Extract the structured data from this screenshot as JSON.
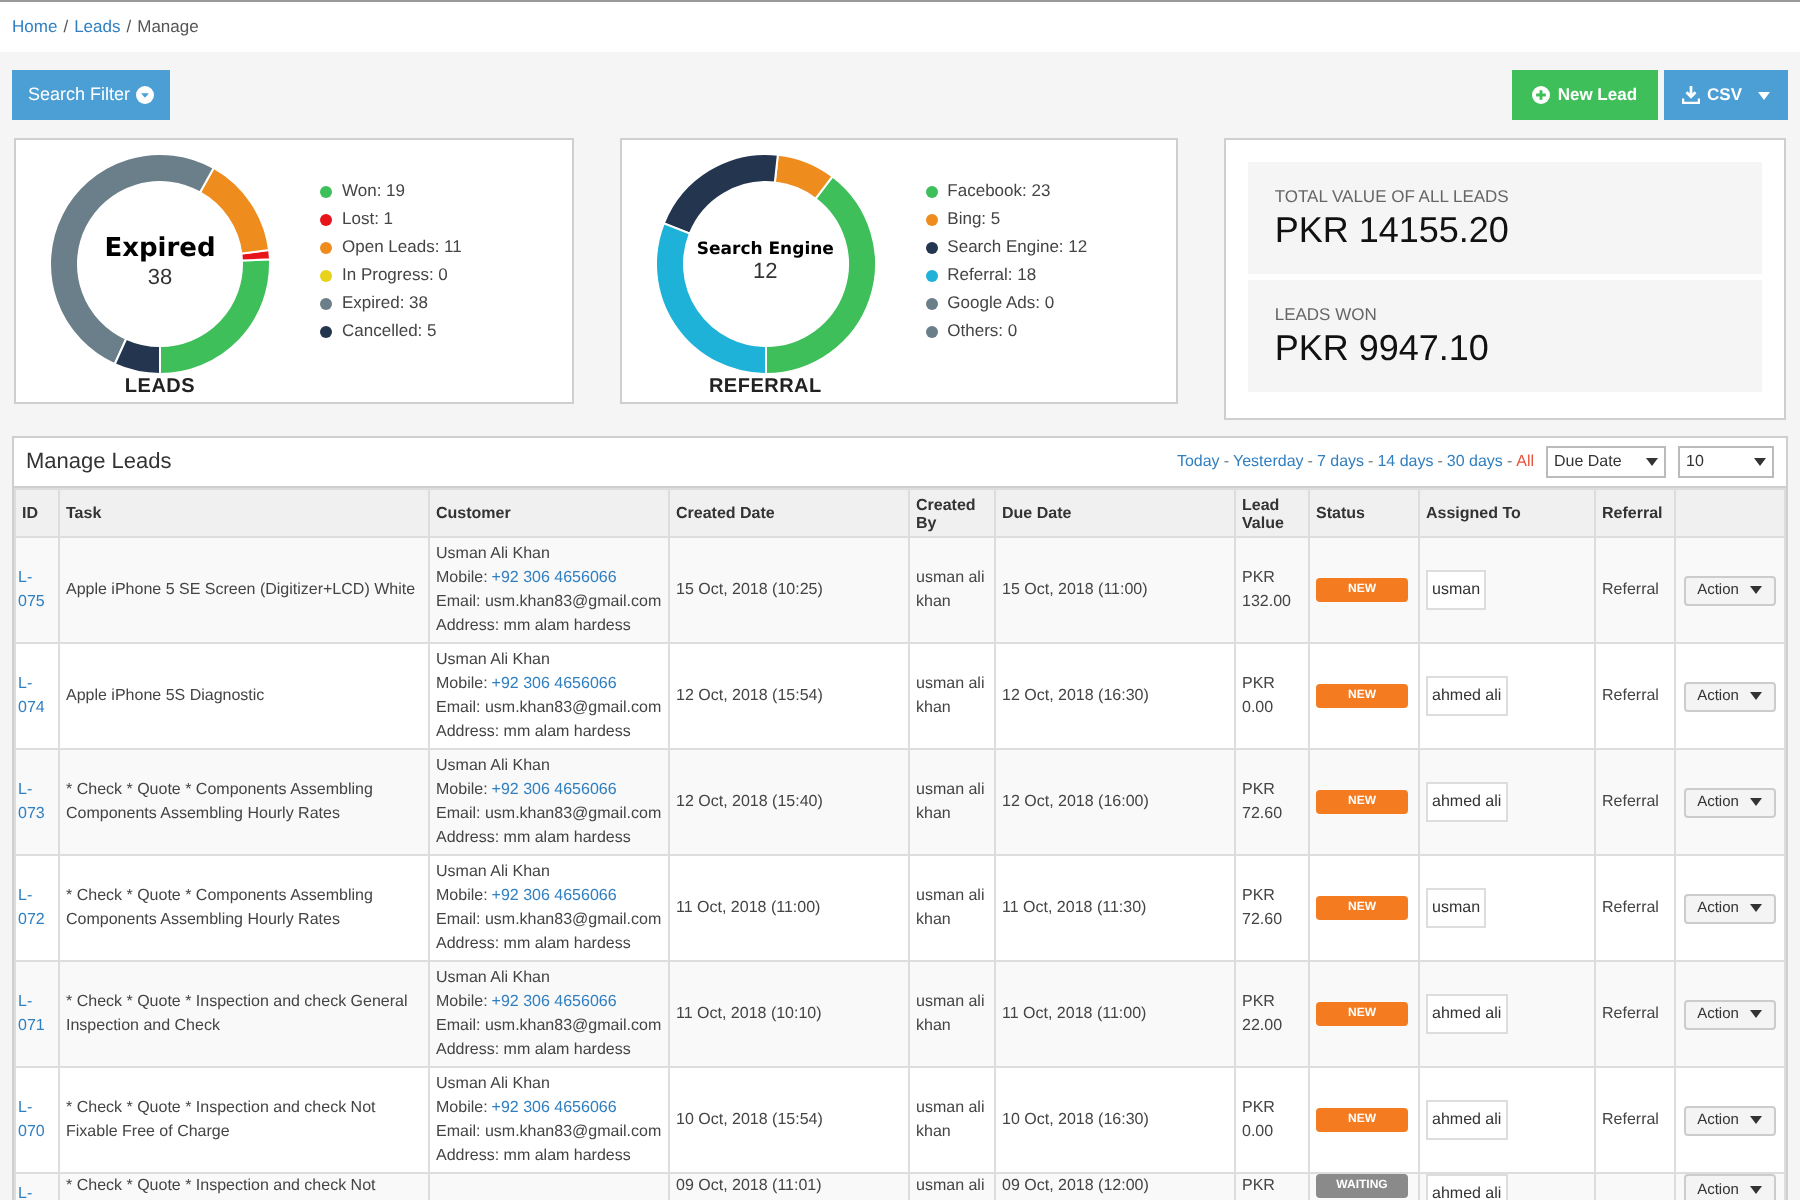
{
  "breadcrumb": {
    "separator": "/",
    "items": [
      {
        "label": "Home",
        "link": true
      },
      {
        "label": "Leads",
        "link": true
      },
      {
        "label": "Manage",
        "link": false
      }
    ]
  },
  "toolbar": {
    "search_filter": "Search Filter",
    "new_lead": "New Lead",
    "csv": "CSV"
  },
  "charts": [
    {
      "center_title": "Expired",
      "center_value": "38",
      "label": "LEADS",
      "legend": [
        {
          "text": "Won: 19",
          "color": "#3fbf5a"
        },
        {
          "text": "Lost: 1",
          "color": "#e8141c"
        },
        {
          "text": "Open Leads: 11",
          "color": "#ef8c1e"
        },
        {
          "text": "In Progress: 0",
          "color": "#e8d21a"
        },
        {
          "text": "Expired: 38",
          "color": "#6b7f8a"
        },
        {
          "text": "Cancelled: 5",
          "color": "#24364f"
        }
      ],
      "chart_data": {
        "type": "donut",
        "values": [
          25.68,
          1.35,
          14.86,
          0,
          51.35,
          6.76
        ]
      }
    },
    {
      "center_title": "Search Engine",
      "center_value": "12",
      "label": "REFERRAL",
      "legend": [
        {
          "text": "Facebook: 23",
          "color": "#3fbf5a"
        },
        {
          "text": "Bing: 5",
          "color": "#ef8c1e"
        },
        {
          "text": "Search Engine: 12",
          "color": "#24364f"
        },
        {
          "text": "Referral: 18",
          "color": "#1fb2d8"
        },
        {
          "text": "Google Ads: 0",
          "color": "#6b7f8a"
        },
        {
          "text": "Others: 0",
          "color": "#6b7f8a"
        }
      ],
      "chart_data": {
        "type": "donut",
        "values": [
          39.66,
          8.62,
          20.69,
          31.03,
          0,
          0
        ]
      }
    }
  ],
  "stats": [
    {
      "label": "TOTAL VALUE OF ALL LEADS",
      "value": "PKR 14155.20"
    },
    {
      "label": "LEADS WON",
      "value": "PKR 9947.10"
    }
  ],
  "panel": {
    "title": "Manage Leads",
    "separator": "-",
    "filters": [
      {
        "label": "Today",
        "selected": false
      },
      {
        "label": "Yesterday",
        "selected": false
      },
      {
        "label": "7 days",
        "selected": false
      },
      {
        "label": "14 days",
        "selected": false
      },
      {
        "label": "30 days",
        "selected": false
      },
      {
        "label": "All",
        "selected": true
      }
    ],
    "sort_select": "Due Date",
    "count_select": "10"
  },
  "table": {
    "columns": [
      "ID",
      "Task",
      "Customer",
      "Created Date",
      "Created By",
      "Due Date",
      "Lead Value",
      "Status",
      "Assigned To",
      "Referral"
    ],
    "rows": [
      {
        "id": "L-075",
        "task": "Apple iPhone 5 SE Screen (Digitizer+LCD) White",
        "customer": {
          "name": "Usman Ali Khan",
          "mobile_label": "Mobile:",
          "mobile": "+92 306 4656066",
          "email": "Email: usm.khan83@gmail.com",
          "address": "Address: mm alam hardess"
        },
        "created": "15 Oct, 2018 (10:25)",
        "created_by": "usman ali khan",
        "due": "15 Oct, 2018 (11:00)",
        "value": "PKR 132.00",
        "status": {
          "text": "NEW",
          "color": "#f47b20"
        },
        "assigned": "usman",
        "referral": "Referral",
        "action": "Action"
      },
      {
        "id": "L-074",
        "task": "Apple iPhone 5S Diagnostic",
        "customer": {
          "name": "Usman Ali Khan",
          "mobile_label": "Mobile:",
          "mobile": "+92 306 4656066",
          "email": "Email: usm.khan83@gmail.com",
          "address": "Address: mm alam hardess"
        },
        "created": "12 Oct, 2018 (15:54)",
        "created_by": "usman ali khan",
        "due": "12 Oct, 2018 (16:30)",
        "value": "PKR 0.00",
        "status": {
          "text": "NEW",
          "color": "#f47b20"
        },
        "assigned": "ahmed ali",
        "referral": "Referral",
        "action": "Action"
      },
      {
        "id": "L-073",
        "task": "* Check * Quote * Components Assembling Components Assembling Hourly Rates",
        "customer": {
          "name": "Usman Ali Khan",
          "mobile_label": "Mobile:",
          "mobile": "+92 306 4656066",
          "email": "Email: usm.khan83@gmail.com",
          "address": "Address: mm alam hardess"
        },
        "created": "12 Oct, 2018 (15:40)",
        "created_by": "usman ali khan",
        "due": "12 Oct, 2018 (16:00)",
        "value": "PKR 72.60",
        "status": {
          "text": "NEW",
          "color": "#f47b20"
        },
        "assigned": "ahmed ali",
        "referral": "Referral",
        "action": "Action"
      },
      {
        "id": "L-072",
        "task": "* Check * Quote * Components Assembling Components Assembling Hourly Rates",
        "customer": {
          "name": "Usman Ali Khan",
          "mobile_label": "Mobile:",
          "mobile": "+92 306 4656066",
          "email": "Email: usm.khan83@gmail.com",
          "address": "Address: mm alam hardess"
        },
        "created": "11 Oct, 2018 (11:00)",
        "created_by": "usman ali khan",
        "due": "11 Oct, 2018 (11:30)",
        "value": "PKR 72.60",
        "status": {
          "text": "NEW",
          "color": "#f47b20"
        },
        "assigned": "usman",
        "referral": "Referral",
        "action": "Action"
      },
      {
        "id": "L-071",
        "task": "* Check * Quote * Inspection and check General Inspection and Check",
        "customer": {
          "name": "Usman Ali Khan",
          "mobile_label": "Mobile:",
          "mobile": "+92 306 4656066",
          "email": "Email: usm.khan83@gmail.com",
          "address": "Address: mm alam hardess"
        },
        "created": "11 Oct, 2018 (10:10)",
        "created_by": "usman ali khan",
        "due": "11 Oct, 2018 (11:00)",
        "value": "PKR 22.00",
        "status": {
          "text": "NEW",
          "color": "#f47b20"
        },
        "assigned": "ahmed ali",
        "referral": "Referral",
        "action": "Action"
      },
      {
        "id": "L-070",
        "task": "* Check * Quote * Inspection and check Not Fixable Free of Charge",
        "customer": {
          "name": "Usman Ali Khan",
          "mobile_label": "Mobile:",
          "mobile": "+92 306 4656066",
          "email": "Email: usm.khan83@gmail.com",
          "address": "Address: mm alam hardess"
        },
        "created": "10 Oct, 2018 (15:54)",
        "created_by": "usman ali khan",
        "due": "10 Oct, 2018 (16:30)",
        "value": "PKR 0.00",
        "status": {
          "text": "NEW",
          "color": "#f47b20"
        },
        "assigned": "ahmed ali",
        "referral": "Referral",
        "action": "Action"
      },
      {
        "id": "L-",
        "task": "* Check * Quote * Inspection and check Not",
        "created": "09 Oct, 2018 (11:01)",
        "created_by": "usman ali",
        "due": "09 Oct, 2018 (12:00)",
        "value": "PKR",
        "status": {
          "text": "WAITING",
          "color": "#8a8a8a"
        },
        "assigned": "ahmed ali",
        "action": "Action"
      }
    ]
  }
}
